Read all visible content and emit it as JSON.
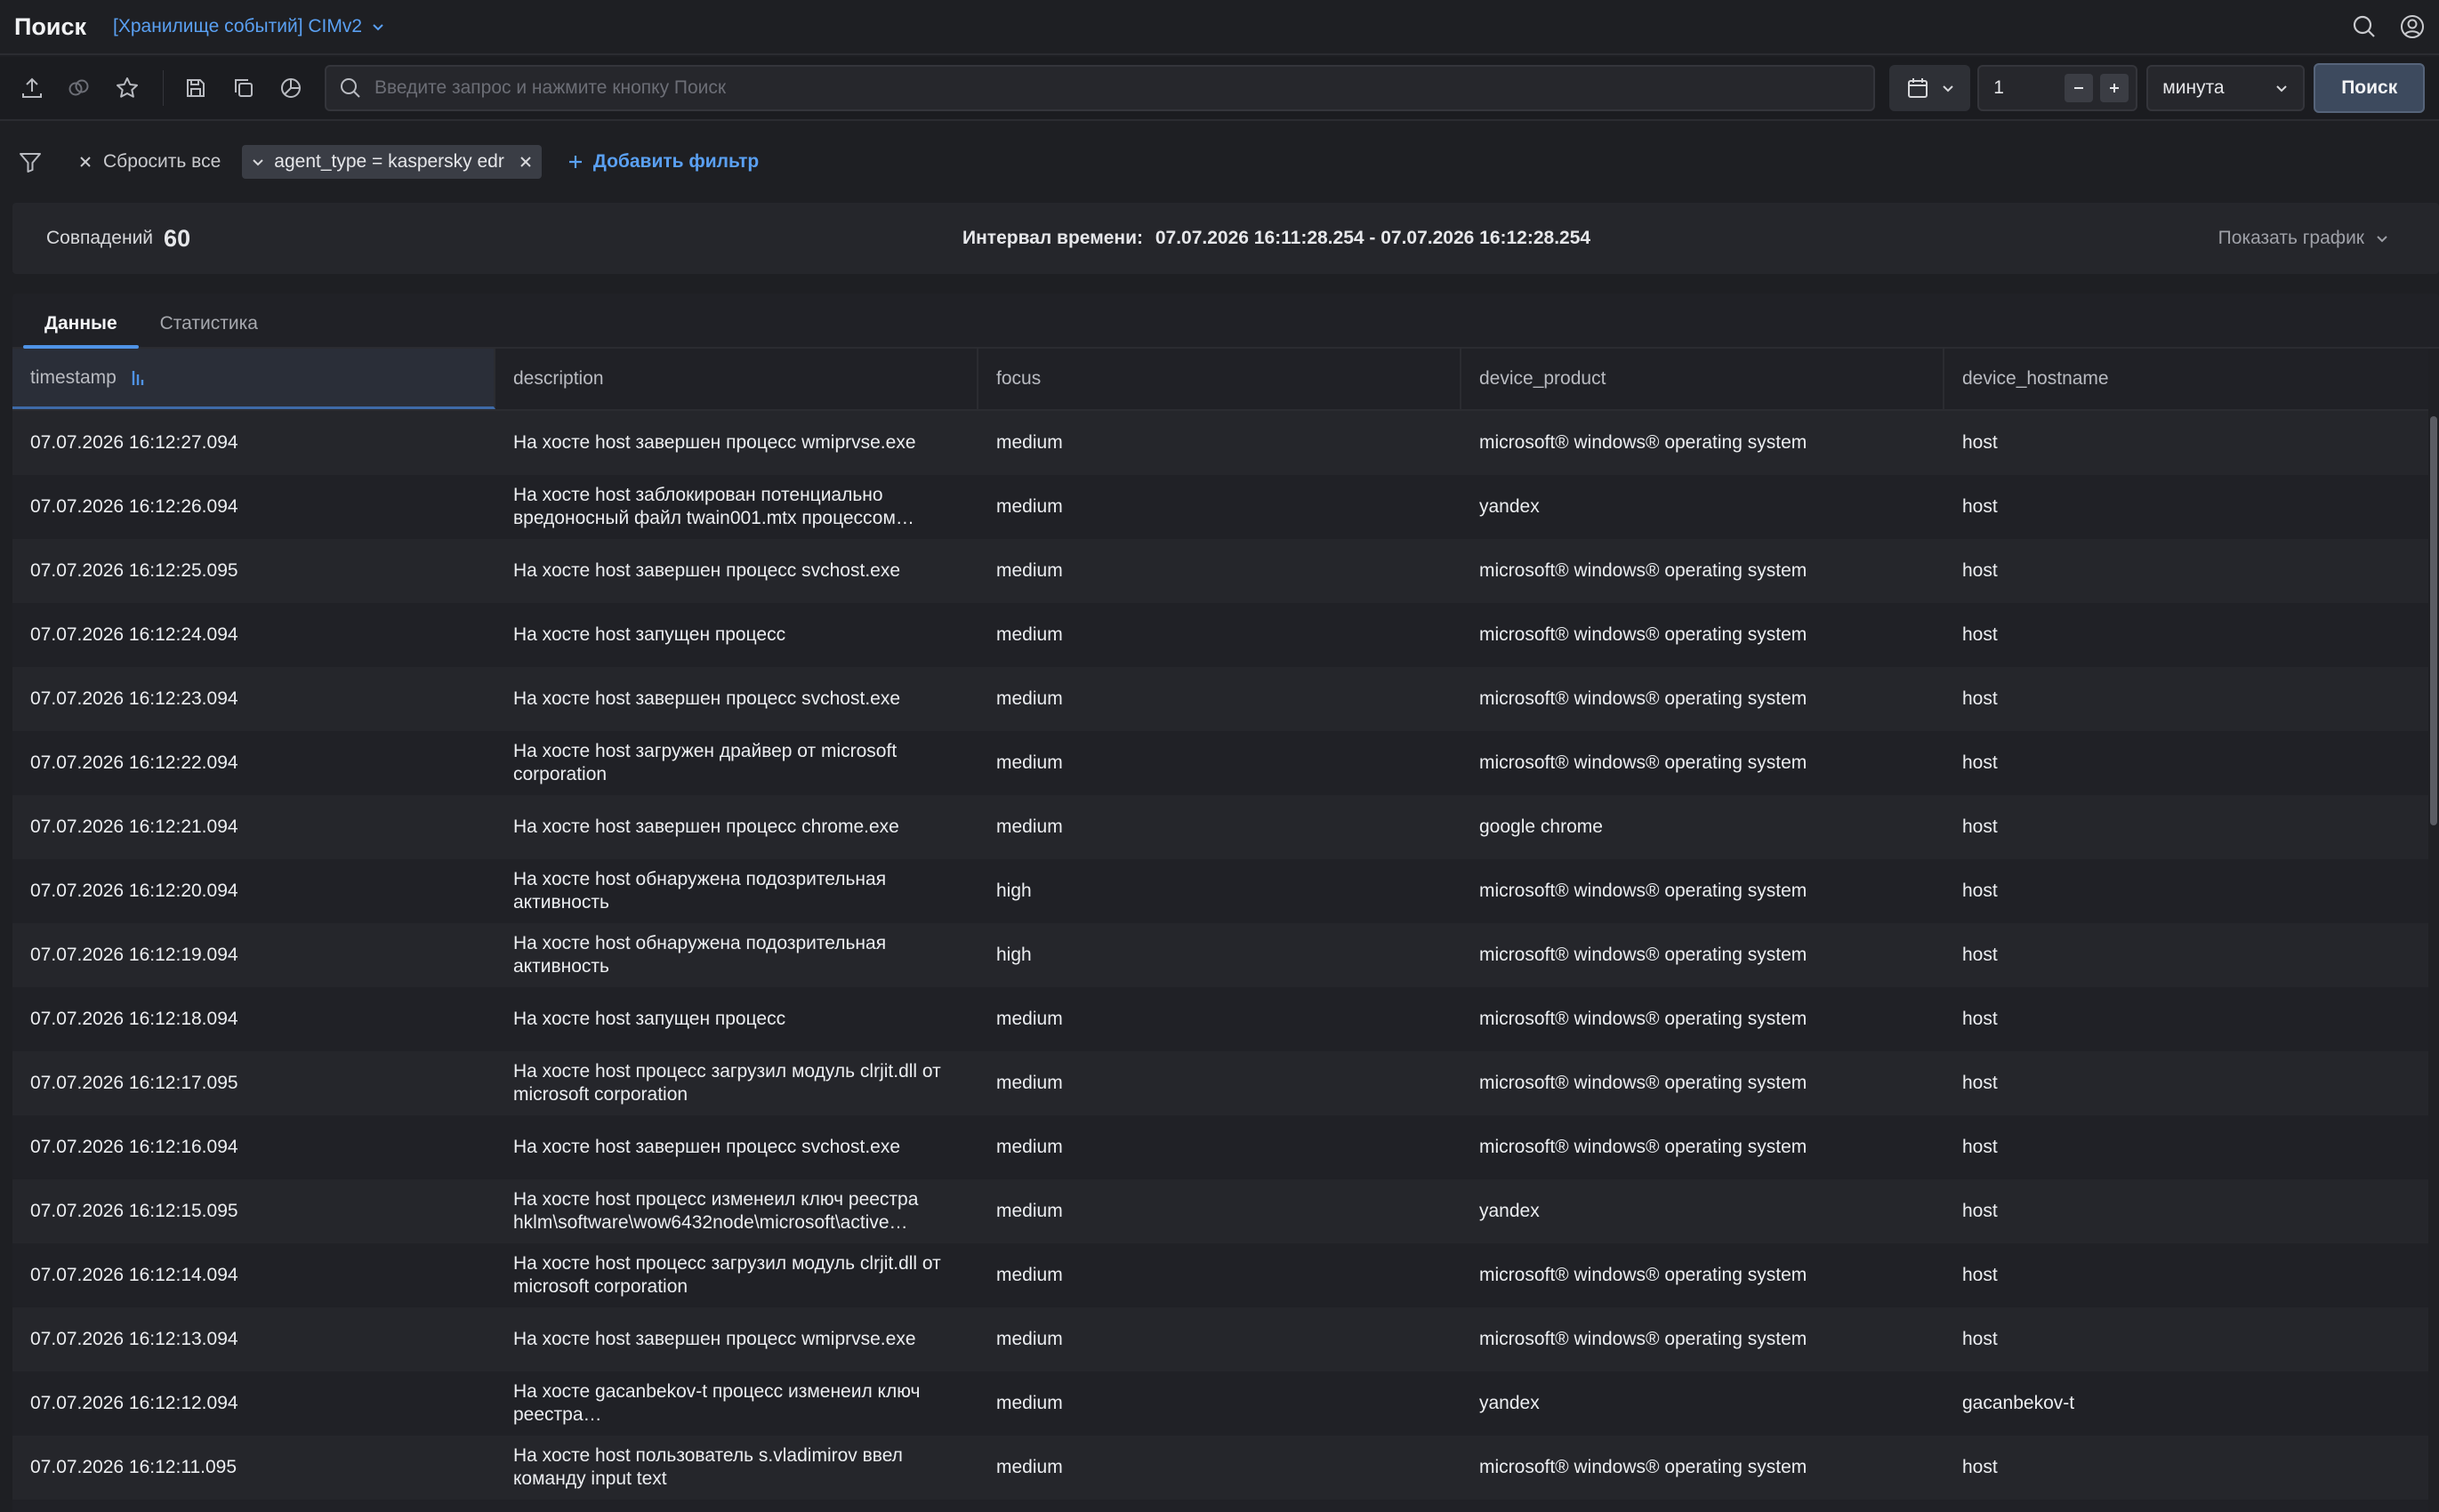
{
  "header": {
    "title": "Поиск",
    "storage": "[Хранилище событий] CIMv2"
  },
  "toolbar": {
    "search_placeholder": "Введите запрос и нажмите кнопку Поиск",
    "period_value": "1",
    "period_unit": "минута",
    "search_button": "Поиск"
  },
  "filters": {
    "reset_label": "Сбросить все",
    "chip_label": "agent_type = kaspersky edr",
    "add_label": "Добавить фильтр"
  },
  "summary": {
    "matches_label": "Совпадений",
    "matches_count": "60",
    "interval_label": "Интервал времени:",
    "interval_value": "07.07.2026 16:11:28.254 - 07.07.2026 16:12:28.254",
    "show_chart_label": "Показать график"
  },
  "tabs": [
    {
      "label": "Данные",
      "active": true
    },
    {
      "label": "Статистика",
      "active": false
    }
  ],
  "table": {
    "columns": [
      "timestamp",
      "description",
      "focus",
      "device_product",
      "device_hostname"
    ],
    "rows": [
      [
        "07.07.2026 16:12:27.094",
        "На хосте host завершен процесс wmiprvse.exe",
        "medium",
        "microsoft® windows® operating system",
        "host"
      ],
      [
        "07.07.2026 16:12:26.094",
        "На хосте host заблокирован потенциально вредоносный файл twain001.mtx процессом…",
        "medium",
        "yandex",
        "host"
      ],
      [
        "07.07.2026 16:12:25.095",
        "На хосте host завершен процесс svchost.exe",
        "medium",
        "microsoft® windows® operating system",
        "host"
      ],
      [
        "07.07.2026 16:12:24.094",
        "На хосте host запущен процесс",
        "medium",
        "microsoft® windows® operating system",
        "host"
      ],
      [
        "07.07.2026 16:12:23.094",
        "На хосте host завершен процесс svchost.exe",
        "medium",
        "microsoft® windows® operating system",
        "host"
      ],
      [
        "07.07.2026 16:12:22.094",
        "На хосте host загружен драйвер от microsoft corporation",
        "medium",
        "microsoft® windows® operating system",
        "host"
      ],
      [
        "07.07.2026 16:12:21.094",
        "На хосте host завершен процесс chrome.exe",
        "medium",
        "google chrome",
        "host"
      ],
      [
        "07.07.2026 16:12:20.094",
        "На хосте host обнаружена подозрительная активность",
        "high",
        "microsoft® windows® operating system",
        "host"
      ],
      [
        "07.07.2026 16:12:19.094",
        "На хосте host обнаружена подозрительная активность",
        "high",
        "microsoft® windows® operating system",
        "host"
      ],
      [
        "07.07.2026 16:12:18.094",
        "На хосте host запущен процесс",
        "medium",
        "microsoft® windows® operating system",
        "host"
      ],
      [
        "07.07.2026 16:12:17.095",
        "На хосте host процесс загрузил модуль clrjit.dll от microsoft corporation",
        "medium",
        "microsoft® windows® operating system",
        "host"
      ],
      [
        "07.07.2026 16:12:16.094",
        "На хосте host завершен процесс svchost.exe",
        "medium",
        "microsoft® windows® operating system",
        "host"
      ],
      [
        "07.07.2026 16:12:15.095",
        "На хосте host процесс изменеил ключ реестра hklm\\software\\wow6432node\\microsoft\\active…",
        "medium",
        "yandex",
        "host"
      ],
      [
        "07.07.2026 16:12:14.094",
        "На хосте host процесс загрузил модуль clrjit.dll от microsoft corporation",
        "medium",
        "microsoft® windows® operating system",
        "host"
      ],
      [
        "07.07.2026 16:12:13.094",
        "На хосте host завершен процесс wmiprvse.exe",
        "medium",
        "microsoft® windows® operating system",
        "host"
      ],
      [
        "07.07.2026 16:12:12.094",
        "На хосте gacanbekov-t процесс изменеил ключ реестра…",
        "medium",
        "yandex",
        "gacanbekov-t"
      ],
      [
        "07.07.2026 16:12:11.095",
        "На хосте host пользователь s.vladimirov ввел команду input text",
        "medium",
        "microsoft® windows® operating system",
        "host"
      ]
    ]
  },
  "colors": {
    "background": "#1e1f23",
    "accent": "#5aa0f2",
    "tab_indicator": "#4f93e6"
  },
  "icons": [
    "search-icon",
    "user-icon",
    "upload-icon",
    "link-icon",
    "star-icon",
    "save-icon",
    "copy-icon",
    "pie-chart-icon",
    "calendar-icon",
    "chevron-down-icon",
    "minus-icon",
    "plus-icon",
    "filter-icon",
    "close-icon",
    "sort-icon"
  ]
}
